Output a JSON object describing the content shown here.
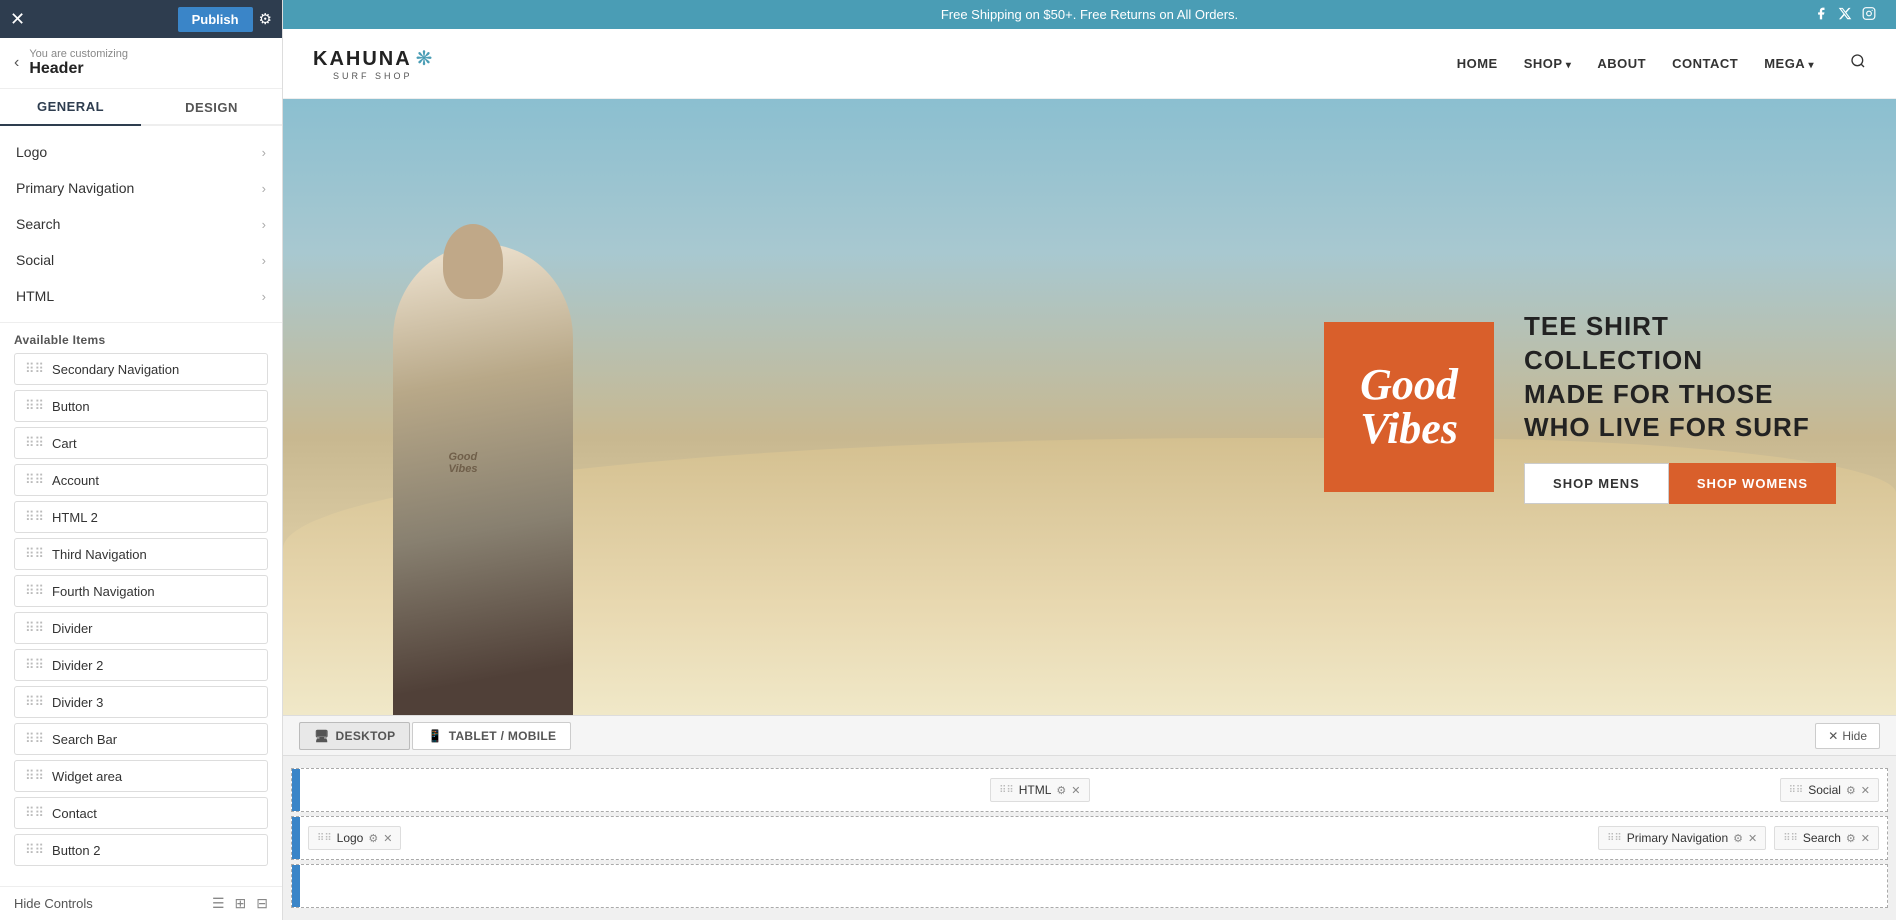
{
  "topBar": {
    "publishLabel": "Publish",
    "closeIcon": "✕",
    "gearIcon": "⚙"
  },
  "breadcrumb": {
    "backIcon": "‹",
    "subText": "You are customizing",
    "mainText": "Header"
  },
  "tabs": {
    "general": "GENERAL",
    "design": "DESIGN"
  },
  "settingsItems": [
    {
      "label": "Logo",
      "id": "logo"
    },
    {
      "label": "Primary Navigation",
      "id": "primary-navigation"
    },
    {
      "label": "Search",
      "id": "search"
    },
    {
      "label": "Social",
      "id": "social"
    },
    {
      "label": "HTML",
      "id": "html"
    }
  ],
  "availableItems": {
    "label": "Available Items",
    "items": [
      "Secondary Navigation",
      "Button",
      "Cart",
      "Account",
      "HTML 2",
      "Third Navigation",
      "Fourth Navigation",
      "Divider",
      "Divider 2",
      "Divider 3",
      "Search Bar",
      "Widget area",
      "Contact",
      "Button 2"
    ]
  },
  "hideControls": "Hide Controls",
  "notification": {
    "text": "Free Shipping on $50+. Free Returns on All Orders."
  },
  "socialIcons": [
    "f",
    "𝕏",
    "📷"
  ],
  "logo": {
    "brandName": "KAHUNA",
    "subText": "SURF SHOP",
    "flowerIcon": "❋"
  },
  "navLinks": [
    {
      "label": "HOME",
      "hasArrow": false
    },
    {
      "label": "SHOP",
      "hasArrow": true
    },
    {
      "label": "ABOUT",
      "hasArrow": false
    },
    {
      "label": "CONTACT",
      "hasArrow": false
    },
    {
      "label": "MEGA",
      "hasArrow": true
    }
  ],
  "hero": {
    "badgeText": "Good\nVibes",
    "taglineLines": [
      "TEE SHIRT",
      "COLLECTION",
      "MADE FOR THOSE",
      "WHO LIVE FOR SURF"
    ],
    "btnMens": "SHOP MENS",
    "btnWomens": "SHOP WOMENS"
  },
  "deviceTabs": {
    "desktop": "DESKTOP",
    "tabletMobile": "TABLET / MOBILE",
    "hideBtn": "Hide"
  },
  "builderRows": [
    {
      "items": [],
      "rightItems": [
        {
          "label": "HTML",
          "id": "html-right"
        }
      ],
      "rightItems2": [
        {
          "label": "Social",
          "id": "social-right"
        }
      ]
    },
    {
      "leftItems": [
        {
          "label": "Logo",
          "id": "logo-builder"
        }
      ],
      "rightItems": [
        {
          "label": "Primary Navigation",
          "id": "primary-nav-builder"
        },
        {
          "label": "Search",
          "id": "search-builder"
        }
      ]
    }
  ],
  "icons": {
    "desktopIcon": "🖥",
    "tabletIcon": "📱",
    "dragHandle": "⠿",
    "gear": "⚙",
    "close": "✕",
    "hideX": "✕"
  }
}
